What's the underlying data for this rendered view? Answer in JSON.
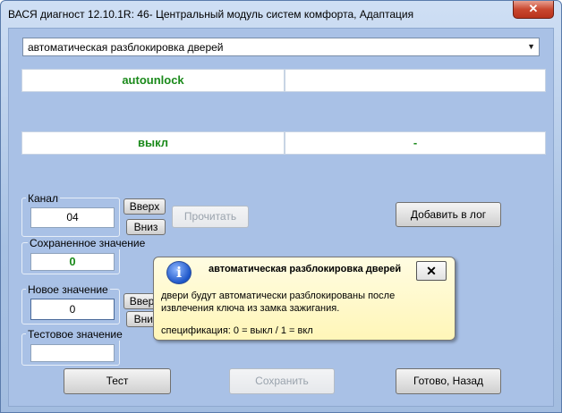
{
  "window": {
    "title": "ВАСЯ диагност 12.10.1R: 46- Центральный модуль систем комфорта, Адаптация",
    "close_glyph": "✕"
  },
  "adaptation_select": {
    "value": "автоматическая разблокировка дверей",
    "arrow_glyph": "▼"
  },
  "grid": {
    "row1": [
      "autounlock",
      ""
    ],
    "row2": [
      "выкл",
      "-"
    ]
  },
  "channel": {
    "label": "Канал",
    "value": "04",
    "up_label": "Вверх",
    "down_label": "Вниз"
  },
  "read_button": "Прочитать",
  "add_to_log_button": "Добавить в лог",
  "saved_value": {
    "label": "Сохраненное значение",
    "value": "0"
  },
  "new_value": {
    "label": "Новое значение",
    "value": "0",
    "up_label": "Вверх",
    "down_label": "Вниз"
  },
  "test_value": {
    "label": "Тестовое значение",
    "value": ""
  },
  "bottom_buttons": {
    "test": "Тест",
    "save": "Сохранить",
    "done": "Готово, Назад"
  },
  "tooltip": {
    "icon_glyph": "i",
    "title": "автоматическая разблокировка дверей",
    "close_glyph": "✕",
    "body": "двери будут автоматически разблокированы после извлечения ключа из замка зажигания.",
    "spec": "спецификация: 0 = выкл / 1 = вкл"
  },
  "colors": {
    "background": "#a9c1e6",
    "value_green": "#1b8a1b",
    "tooltip_bg": "#fff6b8",
    "close_red": "#c9472f"
  }
}
